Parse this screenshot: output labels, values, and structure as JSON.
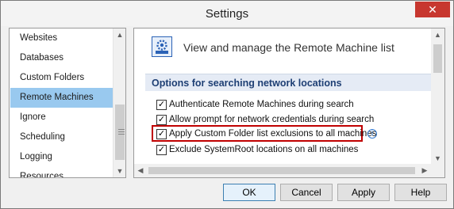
{
  "window": {
    "title": "Settings",
    "close_label": "✕"
  },
  "nav": {
    "items": [
      {
        "label": "Websites",
        "selected": false
      },
      {
        "label": "Databases",
        "selected": false
      },
      {
        "label": "Custom Folders",
        "selected": false
      },
      {
        "label": "Remote Machines",
        "selected": true
      },
      {
        "label": "Ignore",
        "selected": false
      },
      {
        "label": "Scheduling",
        "selected": false
      },
      {
        "label": "Logging",
        "selected": false
      },
      {
        "label": "Resources",
        "selected": false
      }
    ]
  },
  "panel": {
    "heading": "View and manage the Remote Machine list",
    "section_title": "Options for searching network locations",
    "options": [
      {
        "label": "Authenticate Remote Machines during search",
        "checked": true
      },
      {
        "label": "Allow prompt for network credentials during search",
        "checked": true
      },
      {
        "label": "Apply Custom Folder list exclusions to all machines",
        "checked": true,
        "highlighted": true
      },
      {
        "label": "Exclude SystemRoot locations on all machines",
        "checked": true
      }
    ],
    "info_glyph": "i",
    "check_glyph": "✓"
  },
  "buttons": {
    "ok": "OK",
    "cancel": "Cancel",
    "apply": "Apply",
    "help": "Help"
  },
  "colors": {
    "selection": "#99c9ef",
    "highlight_border": "#c00000",
    "close": "#c7372f",
    "section": "#e5ebf5"
  }
}
